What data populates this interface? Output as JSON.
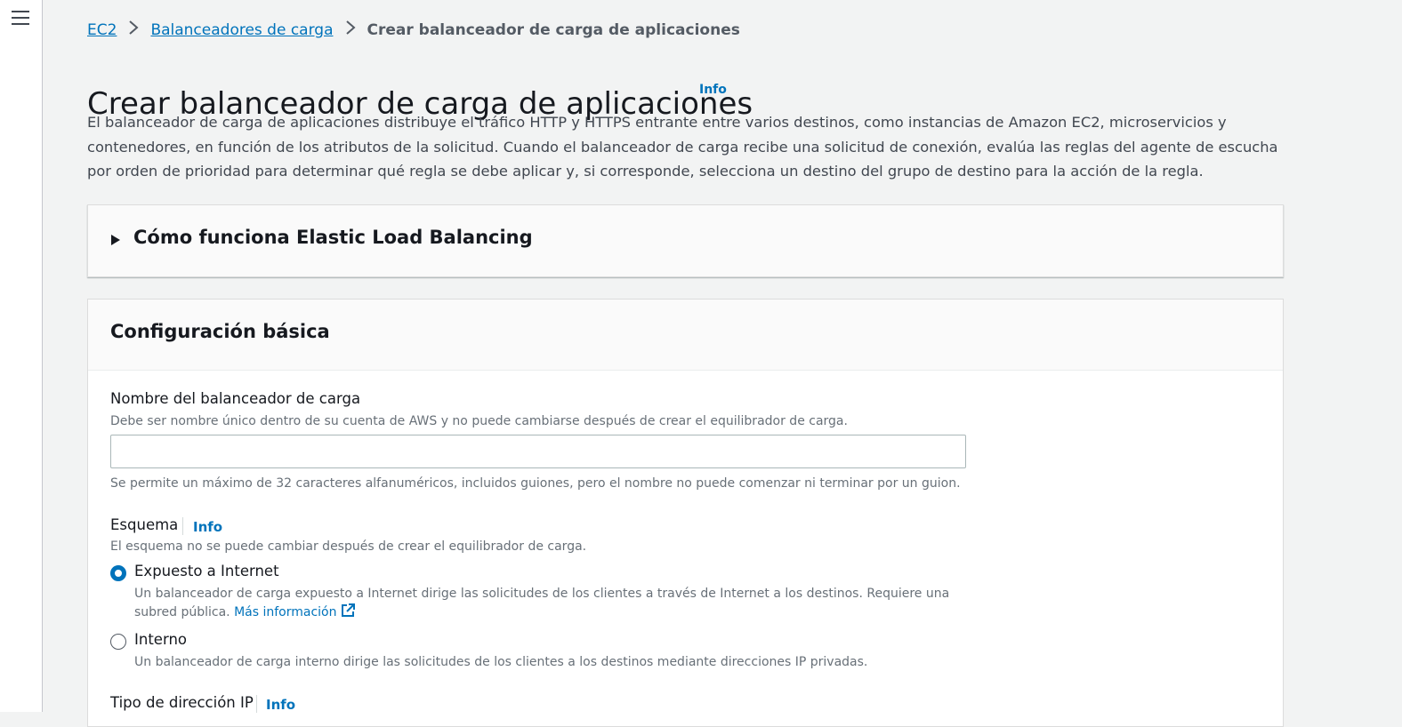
{
  "breadcrumb": {
    "items": [
      "EC2",
      "Balanceadores de carga"
    ],
    "current": "Crear balanceador de carga de aplicaciones"
  },
  "page": {
    "title": "Crear balanceador de carga de aplicaciones",
    "info_label": "Info",
    "description": "El balanceador de carga de aplicaciones distribuye el tráfico HTTP y HTTPS entrante entre varios destinos, como instancias de Amazon EC2, microservicios y contenedores, en función de los atributos de la solicitud. Cuando el balanceador de carga recibe una solicitud de conexión, evalúa las reglas del agente de escucha por orden de prioridad para determinar qué regla se debe aplicar y, si corresponde, selecciona un destino del grupo de destino para la acción de la regla."
  },
  "elb_section": {
    "title": "Cómo funciona Elastic Load Balancing"
  },
  "basic_config": {
    "title": "Configuración básica",
    "name_field": {
      "label": "Nombre del balanceador de carga",
      "description": "Debe ser nombre único dentro de su cuenta de AWS y no puede cambiarse después de crear el equilibrador de carga.",
      "value": "",
      "constraint": "Se permite un máximo de 32 caracteres alfanuméricos, incluidos guiones, pero el nombre no puede comenzar ni terminar por un guion."
    },
    "scheme": {
      "label": "Esquema",
      "info_label": "Info",
      "description": "El esquema no se puede cambiar después de crear el equilibrador de carga.",
      "options": [
        {
          "label": "Expuesto a Internet",
          "description": "Un balanceador de carga expuesto a Internet dirige las solicitudes de los clientes a través de Internet a los destinos. Requiere una subred pública.",
          "link": "Más información",
          "selected": true
        },
        {
          "label": "Interno",
          "description": "Un balanceador de carga interno dirige las solicitudes de los clientes a los destinos mediante direcciones IP privadas.",
          "selected": false
        }
      ]
    },
    "ip_type": {
      "label": "Tipo de dirección IP",
      "info_label": "Info"
    }
  },
  "colors": {
    "link": "#0073bb",
    "background": "#f2f3f3",
    "text": "#16191f",
    "muted": "#687078"
  }
}
